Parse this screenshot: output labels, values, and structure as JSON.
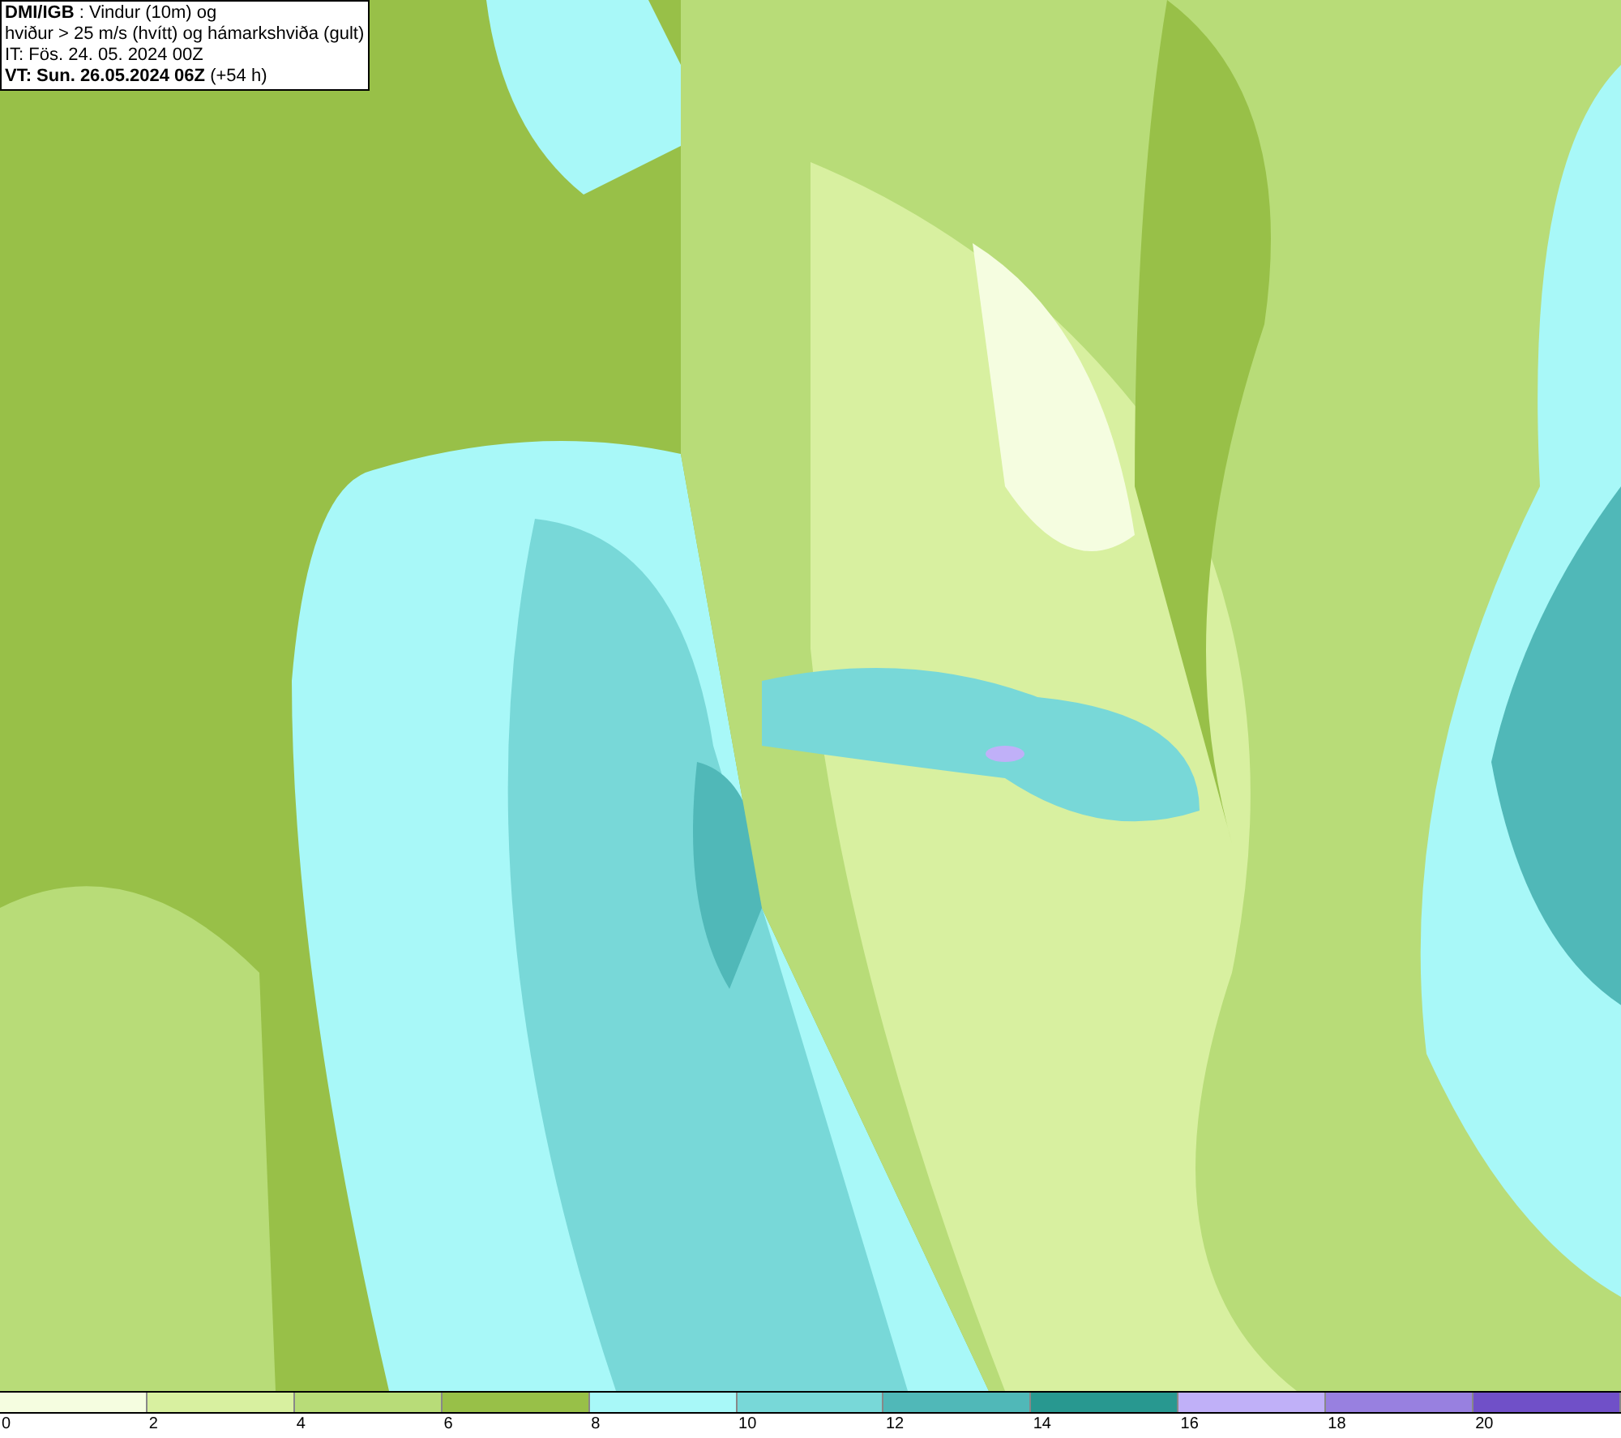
{
  "legend": {
    "lines": [
      "**DMI/IGB** : Vindur (10m) og",
      "hviður > 25 m/s (hvítt) og hámarkshviða (gult)",
      "IT: Fös. 24. 05. 2024 00Z",
      "**VT: Sun. 26.05.2024 06Z** (+54 h)"
    ]
  },
  "colorbar": {
    "segments": [
      {
        "color": "#f5fde0"
      },
      {
        "color": "#d8f0a0"
      },
      {
        "color": "#b8dc78"
      },
      {
        "color": "#98c048"
      },
      {
        "color": "#a8f8f8"
      },
      {
        "color": "#78d8d8"
      },
      {
        "color": "#50b8b8"
      },
      {
        "color": "#289890"
      },
      {
        "color": "#c0b0f8"
      },
      {
        "color": "#9880e0"
      },
      {
        "color": "#7050c8"
      }
    ],
    "ticks": [
      "0",
      "2",
      "4",
      "6",
      "8",
      "10",
      "12",
      "14",
      "16",
      "18",
      "20"
    ]
  }
}
